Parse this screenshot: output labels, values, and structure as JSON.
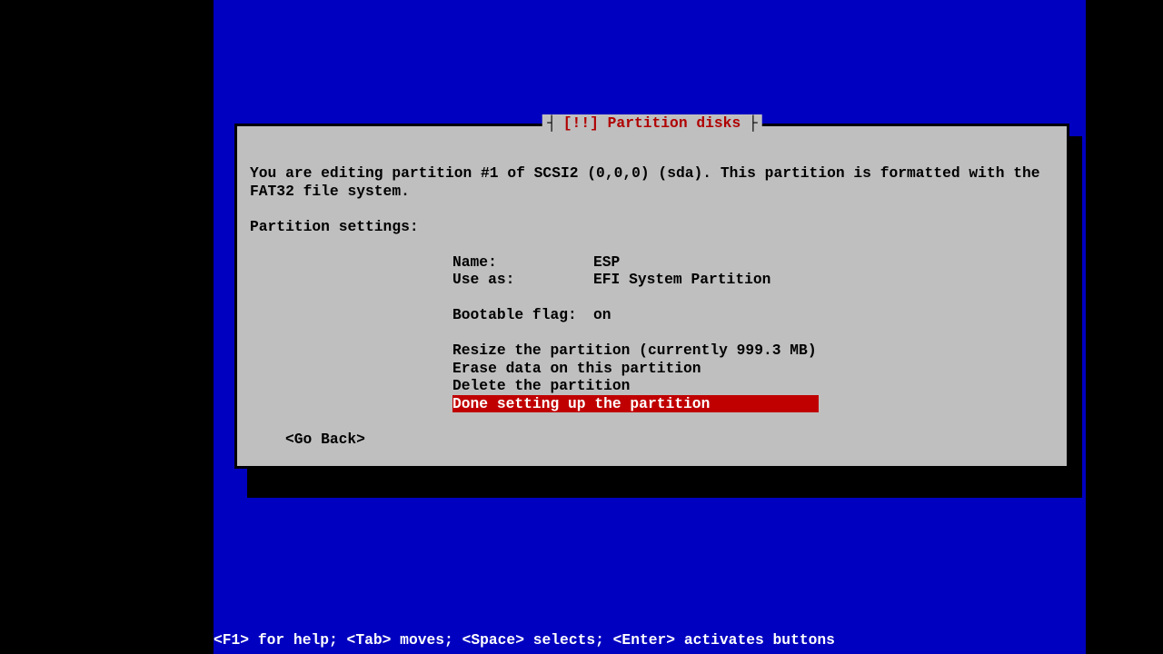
{
  "dialog": {
    "title_marker": "[!!]",
    "title_text": "Partition disks",
    "description": "You are editing partition #1 of SCSI2 (0,0,0) (sda). This partition is formatted with the FAT32 file system.",
    "settings_header": "Partition settings:",
    "settings": {
      "name_label": "Name:",
      "name_value": "ESP",
      "useas_label": "Use as:",
      "useas_value": "EFI System Partition",
      "bootable_label": "Bootable flag:",
      "bootable_value": "on"
    },
    "actions": {
      "resize": "Resize the partition (currently 999.3 MB)",
      "erase": "Erase data on this partition",
      "delete": "Delete the partition",
      "done": "Done setting up the partition"
    },
    "go_back": "<Go Back>"
  },
  "status_bar": "<F1> for help; <Tab> moves; <Space> selects; <Enter> activates buttons"
}
